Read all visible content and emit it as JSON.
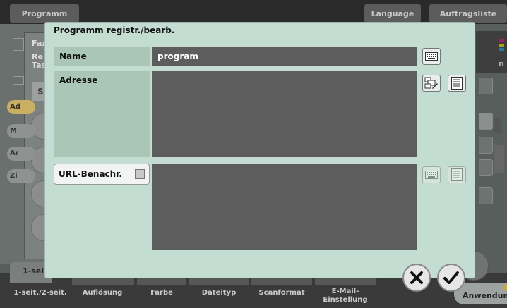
{
  "top_tabs": {
    "program": "Programm",
    "language": "Language",
    "job_list": "Auftragsliste"
  },
  "background": {
    "fax_label": "Fax",
    "re_label": "Re",
    "ta_label": "Tas",
    "s_label": "S",
    "pills": [
      "Ad",
      "M",
      "Ar",
      "Zi"
    ],
    "right_letter": "n",
    "simplex_tab": "1-seit",
    "plex_tab_partial": "1-seit",
    "bottom_tabs": [
      "1-seit./2-seit.",
      "Auflösung",
      "Farbe",
      "Dateityp",
      "Scanformat",
      "E-Mail-\nEinstellung"
    ],
    "application": "Anwendung"
  },
  "dialog": {
    "title": "Programm registr./bearb.",
    "name_label": "Name",
    "name_value": "program",
    "address_label": "Adresse",
    "address_value": "",
    "url_label": "URL-Benachr.",
    "url_value": ""
  },
  "icons": {
    "keyboard": "keyboard-icon",
    "address_book": "address-book-icon",
    "list": "list-icon",
    "cancel": "close-icon",
    "ok": "checkmark-icon"
  },
  "colors": {
    "dialog_bg": "#c4ddd2",
    "label_bg": "#a9c6b6",
    "value_bg": "#5d5d5d"
  }
}
